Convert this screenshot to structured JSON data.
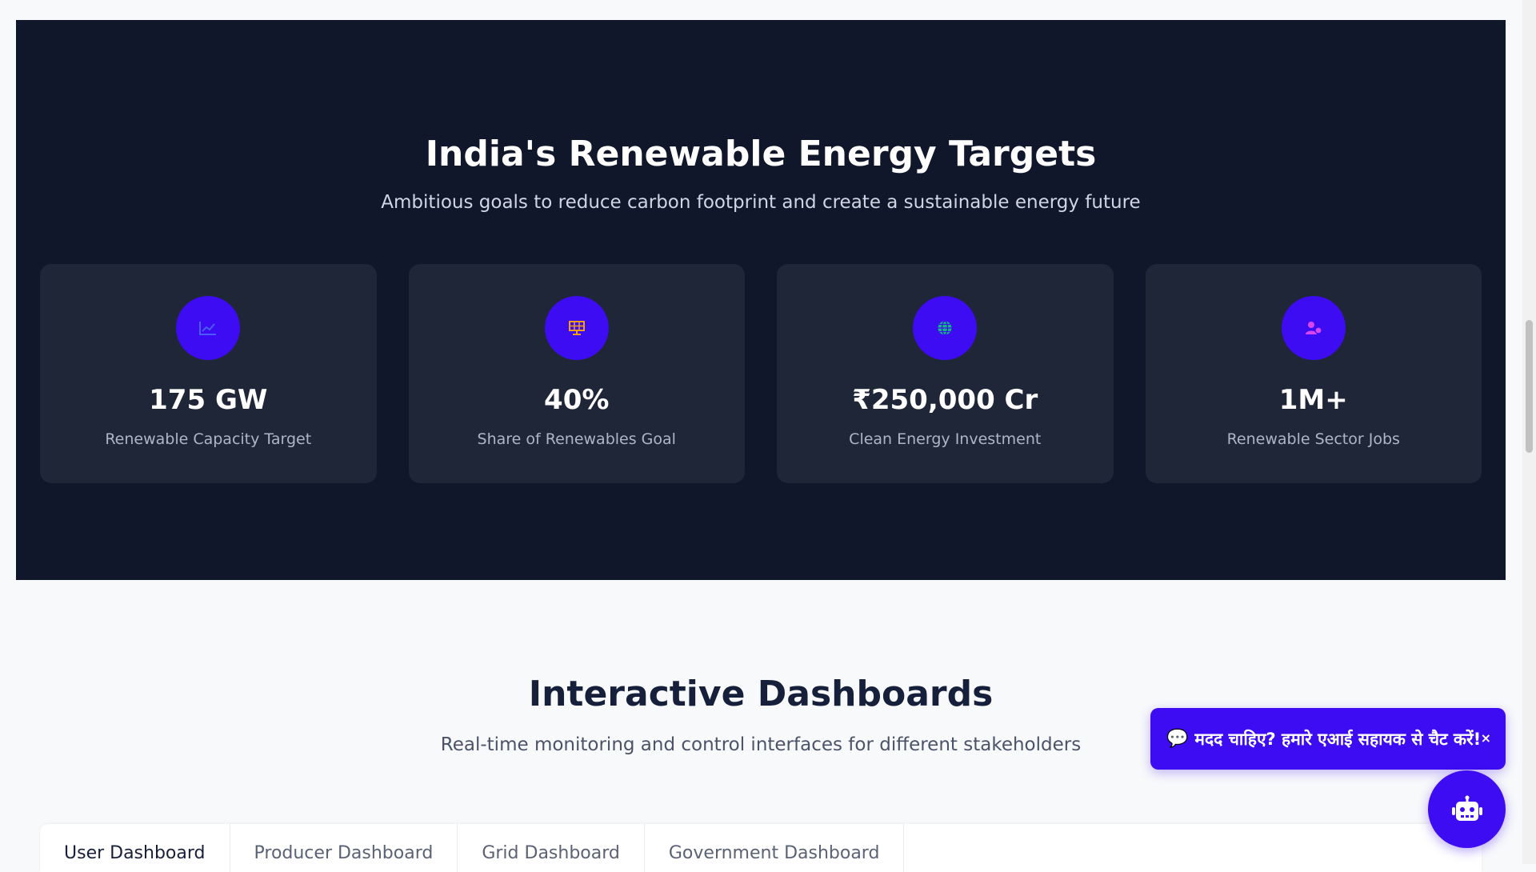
{
  "targets": {
    "title": "India's Renewable Energy Targets",
    "subtitle": "Ambitious goals to reduce carbon footprint and create a sustainable energy future",
    "cards": [
      {
        "icon": "chart-line-icon",
        "icon_color": "#4a5cff",
        "value": "175 GW",
        "label": "Renewable Capacity Target"
      },
      {
        "icon": "solar-panel-icon",
        "icon_color": "#f59e0b",
        "value": "40%",
        "label": "Share of Renewables Goal"
      },
      {
        "icon": "globe-icon",
        "icon_color": "#10b981",
        "value": "₹250,000 Cr",
        "label": "Clean Energy Investment"
      },
      {
        "icon": "user-leaf-icon",
        "icon_color": "#d946ef",
        "value": "1M+",
        "label": "Renewable Sector Jobs"
      }
    ]
  },
  "dashboards": {
    "title": "Interactive Dashboards",
    "subtitle": "Real-time monitoring and control interfaces for different stakeholders",
    "tabs": [
      {
        "label": "User Dashboard",
        "active": true
      },
      {
        "label": "Producer Dashboard",
        "active": false
      },
      {
        "label": "Grid Dashboard",
        "active": false
      },
      {
        "label": "Government Dashboard",
        "active": false
      }
    ]
  },
  "chat": {
    "message": "मदद चाहिए? हमारे एआई सहायक से चैट करें!",
    "close_label": "×",
    "accent": "#3d0cf2"
  },
  "colors": {
    "section_dark": "#11172a",
    "card_bg": "#1f2638",
    "accent": "#3d0cf2"
  }
}
